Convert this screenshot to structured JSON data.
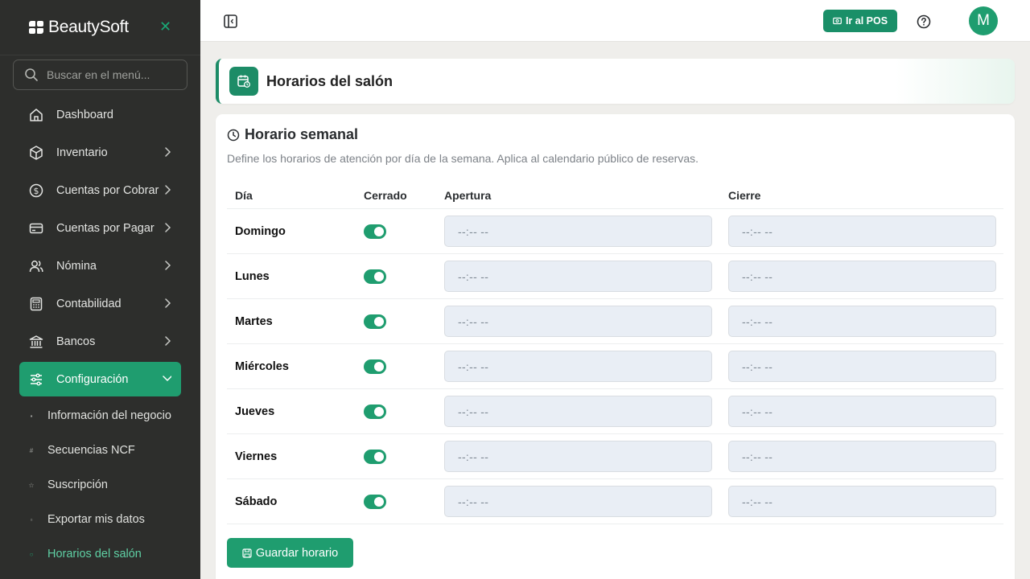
{
  "brand": {
    "name": "BeautySoft"
  },
  "sidebar": {
    "search_placeholder": "Buscar en el menú...",
    "items": [
      {
        "label": "Dashboard",
        "icon": "home-icon",
        "has_children": false
      },
      {
        "label": "Inventario",
        "icon": "box-icon",
        "has_children": true
      },
      {
        "label": "Cuentas por Cobrar",
        "icon": "dollar-circle-icon",
        "has_children": true
      },
      {
        "label": "Cuentas por Pagar",
        "icon": "credit-card-icon",
        "has_children": true
      },
      {
        "label": "Nómina",
        "icon": "users-icon",
        "has_children": true
      },
      {
        "label": "Contabilidad",
        "icon": "calculator-icon",
        "has_children": true
      },
      {
        "label": "Bancos",
        "icon": "bank-icon",
        "has_children": true
      },
      {
        "label": "Configuración",
        "icon": "sliders-icon",
        "has_children": true,
        "active": true
      }
    ],
    "subitems": [
      {
        "label": "Información del negocio",
        "icon": "info-icon"
      },
      {
        "label": "Secuencias NCF",
        "icon": "hash-icon"
      },
      {
        "label": "Suscripción",
        "icon": "star-icon"
      },
      {
        "label": "Exportar mis datos",
        "icon": "download-icon"
      },
      {
        "label": "Horarios del salón",
        "icon": "dot-icon",
        "current": true
      }
    ]
  },
  "topbar": {
    "pos_button": "Ir al POS",
    "avatar_initial": "M"
  },
  "page": {
    "title": "Horarios del salón"
  },
  "schedule": {
    "title": "Horario semanal",
    "description": "Define los horarios de atención por día de la semana. Aplica al calendario público de reservas.",
    "columns": {
      "day": "Día",
      "closed": "Cerrado",
      "open": "Apertura",
      "close": "Cierre"
    },
    "rows": [
      {
        "day": "Domingo",
        "closed": true,
        "open": "--:-- --",
        "close": "--:-- --"
      },
      {
        "day": "Lunes",
        "closed": true,
        "open": "--:-- --",
        "close": "--:-- --"
      },
      {
        "day": "Martes",
        "closed": true,
        "open": "--:-- --",
        "close": "--:-- --"
      },
      {
        "day": "Miércoles",
        "closed": true,
        "open": "--:-- --",
        "close": "--:-- --"
      },
      {
        "day": "Jueves",
        "closed": true,
        "open": "--:-- --",
        "close": "--:-- --"
      },
      {
        "day": "Viernes",
        "closed": true,
        "open": "--:-- --",
        "close": "--:-- --"
      },
      {
        "day": "Sábado",
        "closed": true,
        "open": "--:-- --",
        "close": "--:-- --"
      }
    ],
    "save_label": "Guardar horario"
  },
  "colors": {
    "accent": "#1f9d6f",
    "sidebar_bg": "#2d2e2c",
    "input_bg": "#e9eef5"
  }
}
